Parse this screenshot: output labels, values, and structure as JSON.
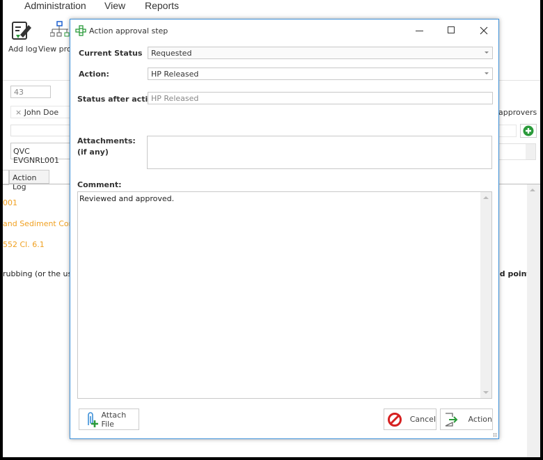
{
  "menu": [
    "Administration",
    "View",
    "Reports"
  ],
  "toolbar": {
    "add_log": "Add log",
    "view_progress": "View prog"
  },
  "form": {
    "id_value": "43",
    "assignee_tag": "John  Doe",
    "code_value": "QVC EVGNRL001",
    "approvers_label": "approvers"
  },
  "tabs": {
    "action_log": "Action Log"
  },
  "content": {
    "line1": "001",
    "line2": "and Sediment Control",
    "line3": "552 Cl. 6.1",
    "line4": "rubbing (or the use o",
    "line5": "ld point"
  },
  "dialog": {
    "title": "Action approval step",
    "current_status_label": "Current Status",
    "current_status_value": "Requested",
    "action_label": "Action:",
    "action_value": "HP Released",
    "status_after_label": "Status after action:",
    "status_after_value": "HP Released",
    "attachments_label": "Attachments:",
    "attachments_sub": "(if any)",
    "comment_label": "Comment:",
    "comment_value": "Reviewed and approved.",
    "attach_file": "Attach File",
    "cancel": "Cancel",
    "action_button": "Action"
  },
  "colors": {
    "accent": "#3c8fd8",
    "orange_text": "#f0a020",
    "cancel_red": "#d62020",
    "green": "#2a9a3a"
  }
}
